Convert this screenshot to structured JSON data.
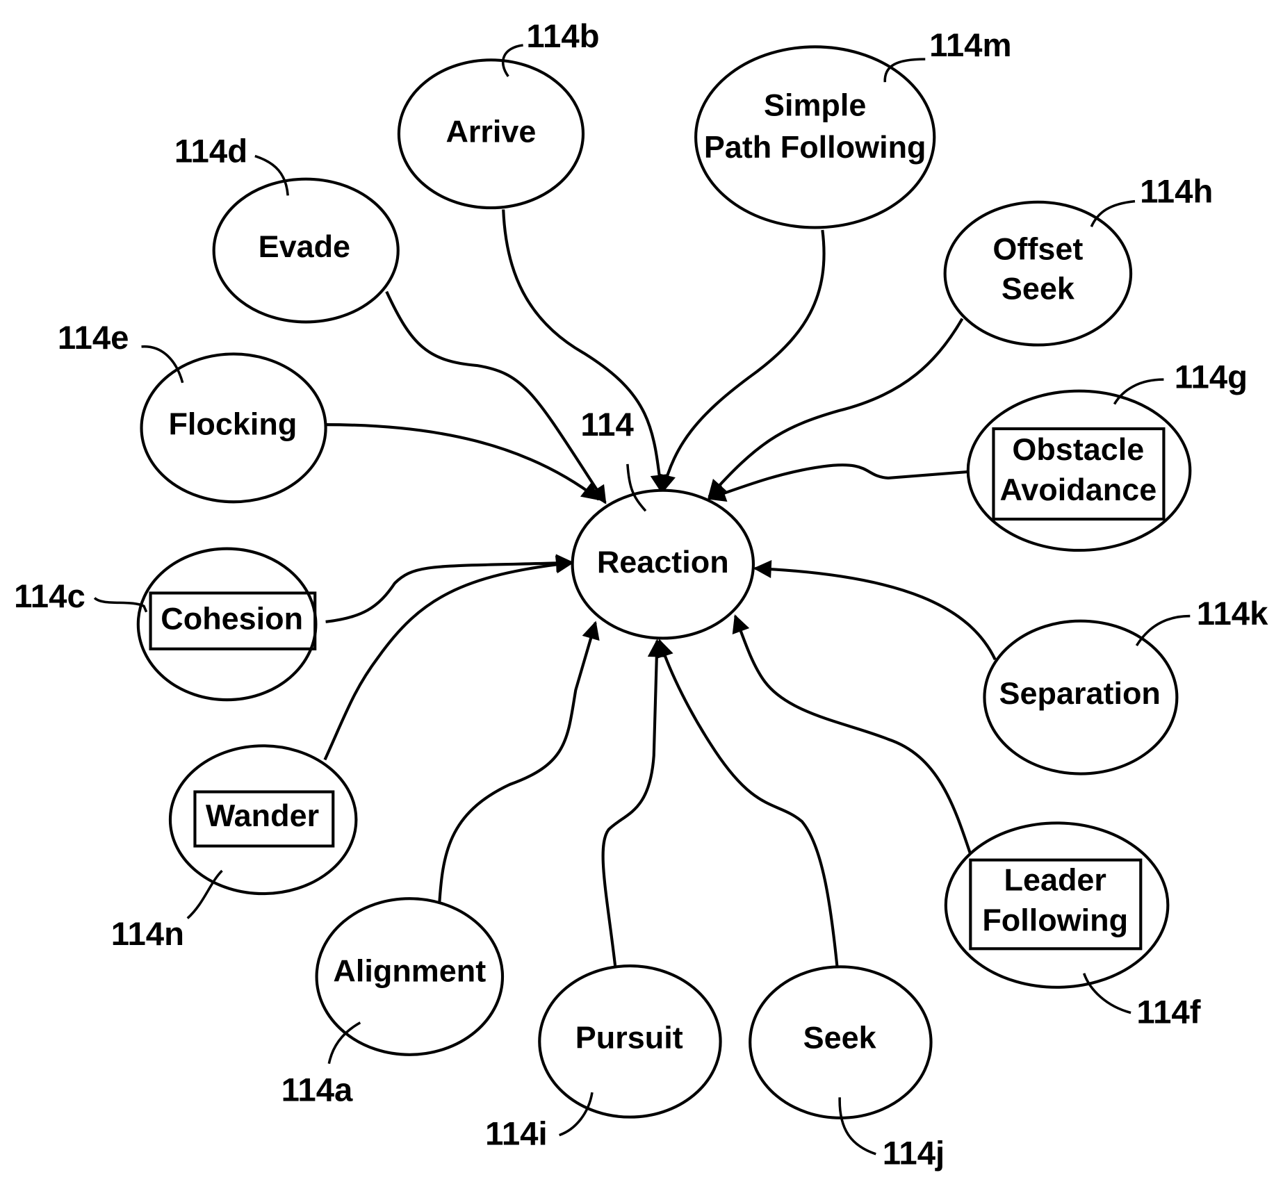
{
  "diagram": {
    "center": {
      "id": "reaction",
      "label": "Reaction",
      "ref": "114"
    },
    "nodes": [
      {
        "id": "alignment",
        "lines": [
          "Alignment"
        ],
        "ref": "114a",
        "boxed": false
      },
      {
        "id": "arrive",
        "lines": [
          "Arrive"
        ],
        "ref": "114b",
        "boxed": false
      },
      {
        "id": "cohesion",
        "lines": [
          "Cohesion"
        ],
        "ref": "114c",
        "boxed": true
      },
      {
        "id": "evade",
        "lines": [
          "Evade"
        ],
        "ref": "114d",
        "boxed": false
      },
      {
        "id": "flocking",
        "lines": [
          "Flocking"
        ],
        "ref": "114e",
        "boxed": false
      },
      {
        "id": "leader-following",
        "lines": [
          "Leader",
          "Following"
        ],
        "ref": "114f",
        "boxed": true
      },
      {
        "id": "obstacle-avoidance",
        "lines": [
          "Obstacle",
          "Avoidance"
        ],
        "ref": "114g",
        "boxed": true
      },
      {
        "id": "offset-seek",
        "lines": [
          "Offset",
          "Seek"
        ],
        "ref": "114h",
        "boxed": false
      },
      {
        "id": "pursuit",
        "lines": [
          "Pursuit"
        ],
        "ref": "114i",
        "boxed": false
      },
      {
        "id": "seek",
        "lines": [
          "Seek"
        ],
        "ref": "114j",
        "boxed": false
      },
      {
        "id": "separation",
        "lines": [
          "Separation"
        ],
        "ref": "114k",
        "boxed": false
      },
      {
        "id": "simple-path-following",
        "lines": [
          "Simple",
          "Path Following"
        ],
        "ref": "114m",
        "boxed": false
      },
      {
        "id": "wander",
        "lines": [
          "Wander"
        ],
        "ref": "114n",
        "boxed": true
      }
    ],
    "edges": [
      {
        "from": "arrive",
        "to": "reaction"
      },
      {
        "from": "simple-path-following",
        "to": "reaction"
      },
      {
        "from": "evade",
        "to": "reaction"
      },
      {
        "from": "offset-seek",
        "to": "reaction"
      },
      {
        "from": "flocking",
        "to": "reaction"
      },
      {
        "from": "obstacle-avoidance",
        "to": "reaction"
      },
      {
        "from": "cohesion",
        "to": "reaction"
      },
      {
        "from": "wander",
        "to": "reaction"
      },
      {
        "from": "separation",
        "to": "reaction"
      },
      {
        "from": "alignment",
        "to": "reaction"
      },
      {
        "from": "pursuit",
        "to": "reaction"
      },
      {
        "from": "seek",
        "to": "reaction"
      },
      {
        "from": "leader-following",
        "to": "reaction"
      }
    ]
  }
}
